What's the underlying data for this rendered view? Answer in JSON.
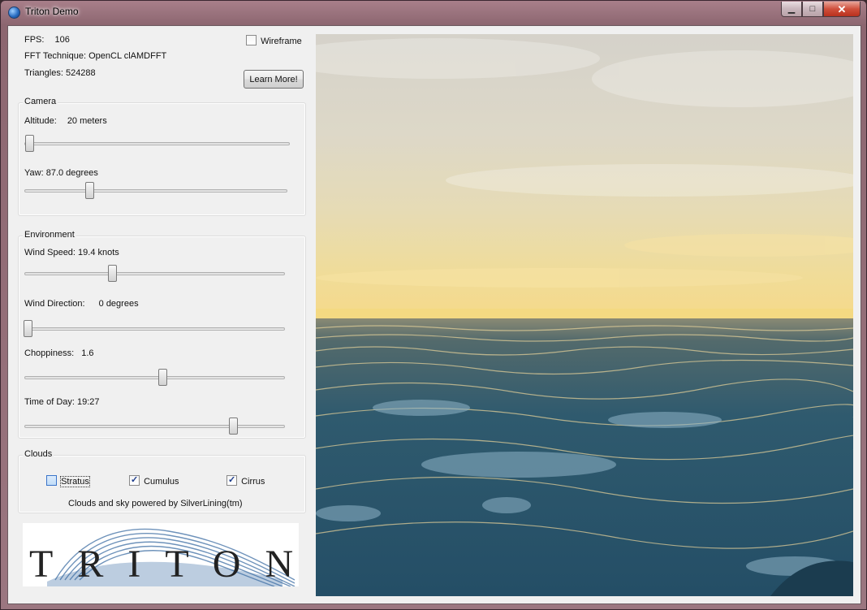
{
  "window": {
    "title": "Triton Demo"
  },
  "stats": {
    "fps_label": "FPS:",
    "fps_value": "106",
    "fft_label": "FFT Technique:",
    "fft_value": "OpenCL clAMDFFT",
    "triangles_label": "Triangles:",
    "triangles_value": "524288"
  },
  "wireframe": {
    "label": "Wireframe",
    "checked": false
  },
  "learn_more": {
    "label": "Learn More!"
  },
  "camera": {
    "title": "Camera",
    "altitude": {
      "label": "Altitude:",
      "value": "20 meters",
      "position": 0.02
    },
    "yaw": {
      "label": "Yaw:",
      "value": "87.0 degrees",
      "position": 0.25
    }
  },
  "environment": {
    "title": "Environment",
    "wind_speed": {
      "label": "Wind Speed:",
      "value": "19.4 knots",
      "position": 0.34
    },
    "wind_direction": {
      "label": "Wind Direction:",
      "value": "0 degrees",
      "position": 0.0
    },
    "choppiness": {
      "label": "Choppiness:",
      "value": "1.6",
      "position": 0.53
    },
    "time_of_day": {
      "label": "Time of Day:",
      "value": "19:27",
      "position": 0.81
    }
  },
  "clouds": {
    "title": "Clouds",
    "stratus": {
      "label": "Stratus",
      "checked": false
    },
    "cumulus": {
      "label": "Cumulus",
      "checked": true
    },
    "cirrus": {
      "label": "Cirrus",
      "checked": true
    },
    "powered_by": "Clouds and sky powered by SilverLining(tm)"
  },
  "logo": {
    "text": "TRITON"
  },
  "colors": {
    "ocean": "#2e5a70",
    "sky_glow": "#f3dc8c",
    "sky_top": "#d8d4cc"
  }
}
